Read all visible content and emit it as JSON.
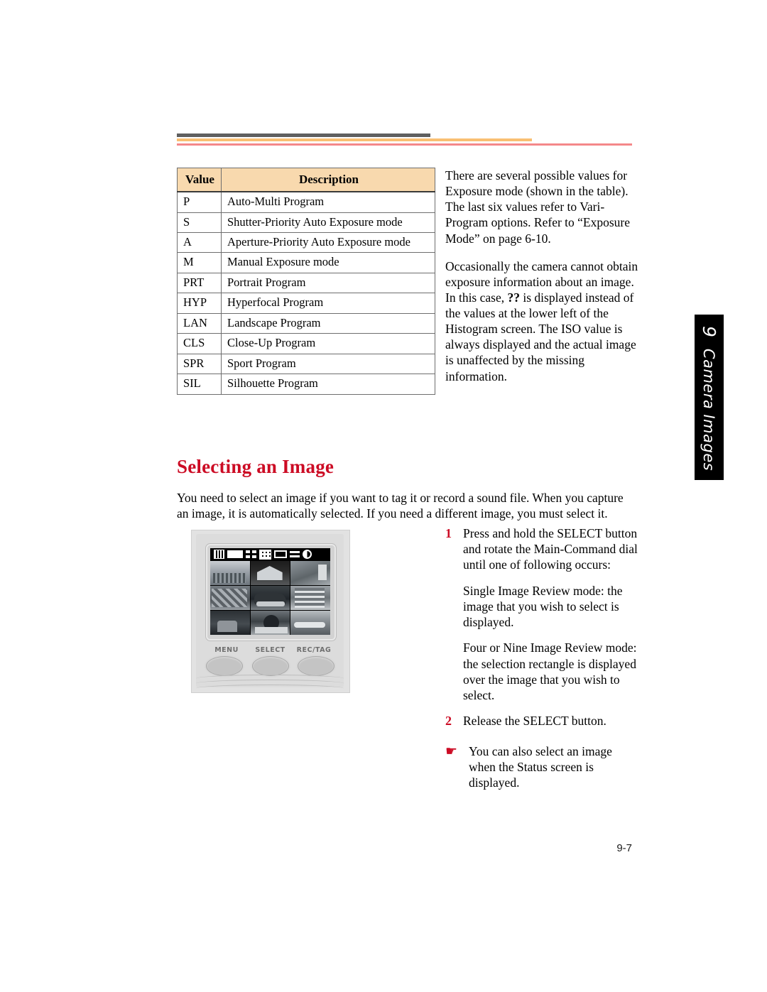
{
  "header": {
    "rule_dark_color": "#5f5f5f",
    "rule_orange_color": "#f9bf72",
    "rule_red_color": "#f4888a"
  },
  "side_tab": {
    "chapter_number": "9",
    "label": "Camera Images",
    "background_color": "#000000",
    "text_color": "#ffffff"
  },
  "modes_table": {
    "headers": [
      "Value",
      "Description"
    ],
    "header_background": "#f8d9ae",
    "rows": [
      {
        "value": "P",
        "description": "Auto-Multi Program"
      },
      {
        "value": "S",
        "description": "Shutter-Priority Auto Exposure mode"
      },
      {
        "value": "A",
        "description": "Aperture-Priority Auto Exposure mode"
      },
      {
        "value": "M",
        "description": "Manual Exposure mode"
      },
      {
        "value": "PRT",
        "description": "Portrait Program"
      },
      {
        "value": "HYP",
        "description": "Hyperfocal Program"
      },
      {
        "value": "LAN",
        "description": "Landscape Program"
      },
      {
        "value": "CLS",
        "description": "Close-Up Program"
      },
      {
        "value": "SPR",
        "description": "Sport Program"
      },
      {
        "value": "SIL",
        "description": "Silhouette Program"
      }
    ]
  },
  "right_intro": {
    "paragraph_1": "There are several possible values for Exposure mode (shown in the table). The last six values refer to Vari-Program options. Refer to “Exposure Mode” on page 6-10.",
    "paragraph_2_before": "Occasionally the camera cannot obtain exposure information about an image. In this case, ",
    "paragraph_2_bold": "??",
    "paragraph_2_after": " is displayed instead of the values at the lower left of the Histogram screen. The ISO value is always displayed and the actual image is unaffected by the missing information."
  },
  "section": {
    "heading": "Selecting an Image",
    "heading_color": "#cc0b24",
    "intro": "You need to select an image if you want to tag it or record a sound file. When you capture an image, it is automatically selected. If you need a different image, you must select it."
  },
  "camera_figure": {
    "button_labels": [
      "MENU",
      "SELECT",
      "REC/TAG"
    ],
    "status_icons": [
      "film-icon",
      "blank-screen-icon",
      "four-image-icon",
      "nine-image-icon",
      "folder-icon",
      "bars-icon",
      "battery-icon"
    ],
    "thumbnail_count": 9
  },
  "steps": [
    {
      "number": "1",
      "text": "Press and hold the SELECT button and rotate the Main-Command dial until one of following occurs:"
    },
    {
      "number": "2",
      "text": "Release the SELECT button."
    }
  ],
  "step_continuations": [
    "Single Image Review mode: the image that you wish to select is displayed.",
    "Four or Nine Image Review mode: the selection rectangle is displayed over the image that you wish to select."
  ],
  "note": {
    "bullet": "☛",
    "text": "You can also select an image when the Status screen is displayed."
  },
  "footer": {
    "page_number": "9-7"
  }
}
